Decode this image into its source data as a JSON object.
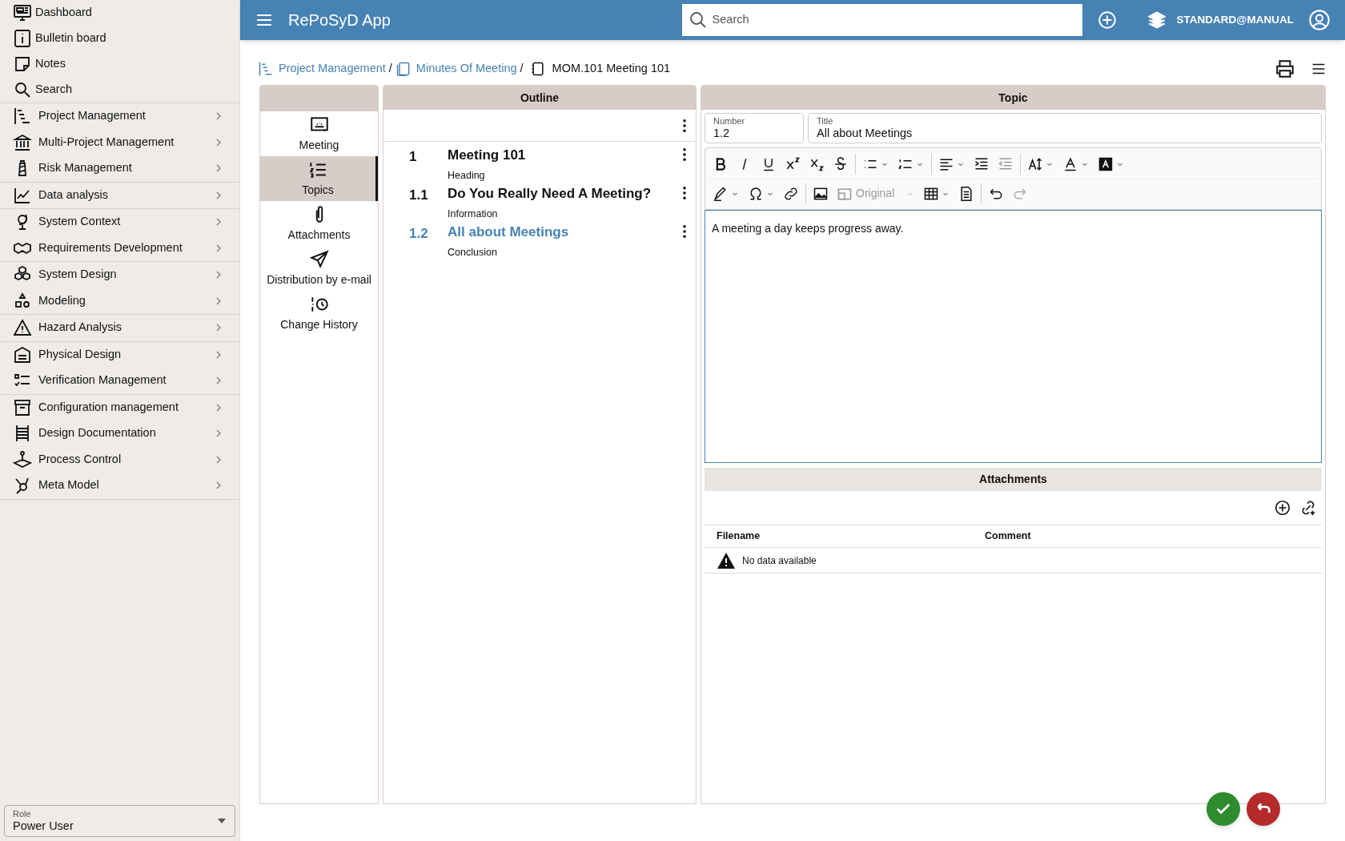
{
  "sidebar": {
    "groups": [
      {
        "items": [
          {
            "label": "Dashboard",
            "kind": "link"
          },
          {
            "label": "Bulletin board",
            "kind": "link"
          },
          {
            "label": "Notes",
            "kind": "link"
          },
          {
            "label": "Search",
            "kind": "link"
          }
        ]
      },
      {
        "items": [
          {
            "label": "Project Management",
            "kind": "menu"
          },
          {
            "label": "Multi-Project Management",
            "kind": "menu"
          },
          {
            "label": "Risk Management",
            "kind": "menu"
          }
        ]
      },
      {
        "items": [
          {
            "label": "Data analysis",
            "kind": "menu"
          }
        ]
      },
      {
        "items": [
          {
            "label": "System Context",
            "kind": "menu"
          },
          {
            "label": "Requirements Development",
            "kind": "menu"
          }
        ]
      },
      {
        "items": [
          {
            "label": "System Design",
            "kind": "menu"
          },
          {
            "label": "Modeling",
            "kind": "menu"
          }
        ]
      },
      {
        "items": [
          {
            "label": "Hazard Analysis",
            "kind": "menu"
          }
        ]
      },
      {
        "items": [
          {
            "label": "Physical Design",
            "kind": "menu"
          },
          {
            "label": "Verification Management",
            "kind": "menu"
          }
        ]
      },
      {
        "items": [
          {
            "label": "Configuration management",
            "kind": "menu"
          },
          {
            "label": "Design Documentation",
            "kind": "menu"
          },
          {
            "label": "Process Control",
            "kind": "menu"
          },
          {
            "label": "Meta Model",
            "kind": "menu"
          }
        ]
      }
    ],
    "role": {
      "label": "Role",
      "value": "Power User"
    }
  },
  "header": {
    "app_title": "RePoSyD App",
    "search": {
      "placeholder": "Search"
    },
    "user": "STANDARD@MANUAL"
  },
  "breadcrumb": {
    "separator": "/",
    "items": [
      {
        "label": "Project Management",
        "kind": "link"
      },
      {
        "label": "Minutes Of Meeting",
        "kind": "link"
      },
      {
        "label": "MOM.101 Meeting 101",
        "kind": "current"
      }
    ]
  },
  "nav_tabs": [
    {
      "label": "Meeting",
      "selected": false
    },
    {
      "label": "Topics",
      "selected": true
    },
    {
      "label": "Attachments",
      "selected": false
    },
    {
      "label": "Distribution by e-mail",
      "selected": false
    },
    {
      "label": "Change History",
      "selected": false
    }
  ],
  "outline": {
    "title": "Outline",
    "items": [
      {
        "number": "1",
        "title": "Meeting 101",
        "type": "Heading",
        "selected": false
      },
      {
        "number": "1.1",
        "title": "Do You Really Need A Meeting?",
        "type": "Information",
        "selected": false
      },
      {
        "number": "1.2",
        "title": "All about Meetings",
        "type": "Conclusion",
        "selected": true
      }
    ]
  },
  "topic": {
    "title": "Topic",
    "number": {
      "label": "Number",
      "value": "1.2"
    },
    "title_field": {
      "label": "Title",
      "value": "All about Meetings"
    },
    "toolbar": {
      "image_size": {
        "label": "Original",
        "disabled": true
      }
    },
    "content": "A meeting a day keeps progress away.",
    "attachments": {
      "title": "Attachments",
      "columns": [
        "Filename",
        "Comment"
      ],
      "empty_message": "No data available"
    }
  }
}
